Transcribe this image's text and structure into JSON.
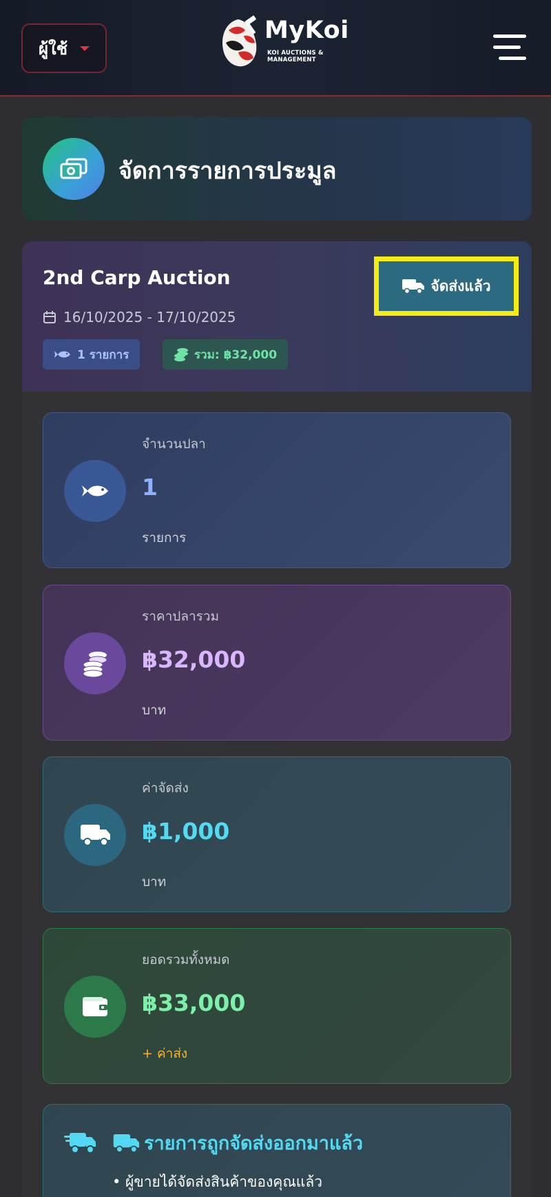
{
  "header": {
    "user_label": "ผู้ใช้",
    "brand_name": "MyKoi",
    "brand_tagline": "KOI AUCTIONS & MANAGEMENT",
    "accent_color": "#e0343f"
  },
  "page": {
    "title": "จัดการรายการประมูล",
    "icon": "money-bill-icon"
  },
  "auction": {
    "title": "2nd Carp Auction",
    "date_range": "16/10/2025 - 17/10/2025",
    "status_button": "จัดส่งแล้ว",
    "badge_items": "1 รายการ",
    "badge_total": "รวม: ฿32,000"
  },
  "stats": [
    {
      "label": "จำนวนปลา",
      "value": "1",
      "unit": "รายการ",
      "icon": "fish-icon",
      "color": "#8eb4ff"
    },
    {
      "label": "ราคาปลารวม",
      "value": "฿32,000",
      "unit": "บาท",
      "icon": "coins-icon",
      "color": "#d9b6ff"
    },
    {
      "label": "ค่าจัดส่ง",
      "value": "฿1,000",
      "unit": "บาท",
      "icon": "truck-icon",
      "color": "#53d9f2"
    },
    {
      "label": "ยอดรวมทั้งหมด",
      "value": "฿33,000",
      "unit": "+ ค่าส่ง",
      "icon": "wallet-icon",
      "color": "#7cf0a8"
    }
  ],
  "notice": {
    "title": "รายการถูกจัดส่งออกมาแล้ว",
    "bullet": "• ผู้ขายได้จัดส่งสินค้าของคุณแล้ว"
  }
}
